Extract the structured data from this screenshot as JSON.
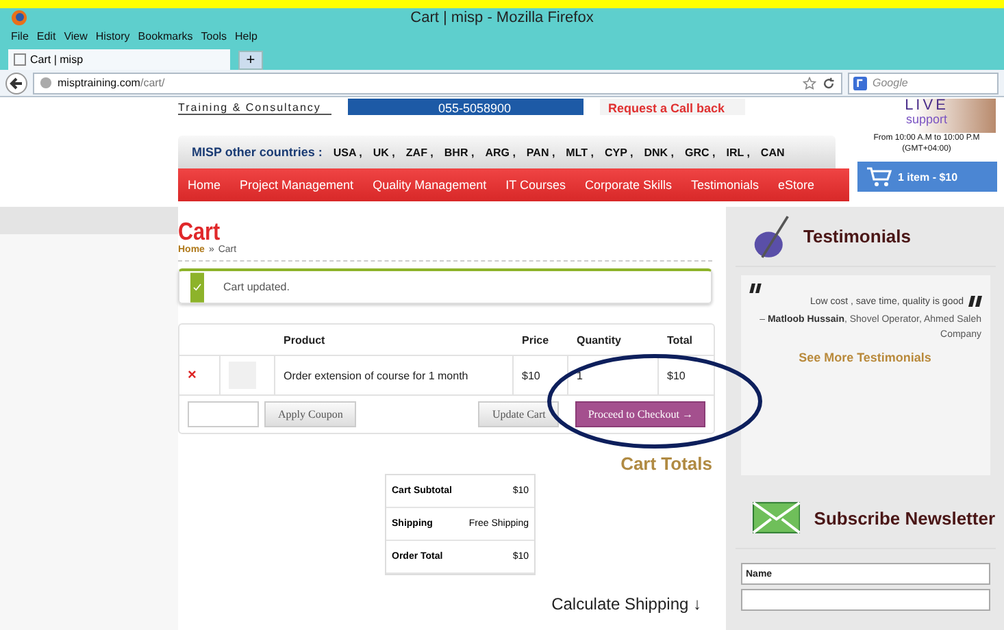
{
  "browser": {
    "title": "Cart | misp - Mozilla Firefox",
    "menu": [
      "File",
      "Edit",
      "View",
      "History",
      "Bookmarks",
      "Tools",
      "Help"
    ],
    "tabs": [
      {
        "label": "Cart | misp",
        "selected": true
      }
    ],
    "new_tab": "+",
    "url_host": "misptraining.com",
    "url_path": "/cart/",
    "search_placeholder": "Google"
  },
  "header": {
    "brand": "Training & Consultancy",
    "phone": "055-5058900",
    "callback": "Request a Call back",
    "live": "LIVE",
    "support": "support",
    "hours": "From 10:00 A.M to 10:00 P.M",
    "timezone": "(GMT+04:00)",
    "cart_button": "1 item - $10"
  },
  "countries": {
    "label": "MISP other countries :",
    "items": [
      "USA ,",
      "UK ,",
      "ZAF ,",
      "BHR ,",
      "ARG ,",
      "PAN ,",
      "MLT ,",
      "CYP ,",
      "DNK ,",
      "GRC ,",
      "IRL ,",
      "CAN"
    ]
  },
  "nav": [
    "Home",
    "Project Management",
    "Quality Management",
    "IT Courses",
    "Corporate Skills",
    "Testimonials",
    "eStore"
  ],
  "cart": {
    "title": "Cart",
    "breadcrumb_home": "Home",
    "breadcrumb_sep": "»",
    "breadcrumb_current": "Cart",
    "message": "Cart updated.",
    "columns": [
      "Product",
      "Price",
      "Quantity",
      "Total"
    ],
    "rows": [
      {
        "remove": "×",
        "product": "Order extension of course for 1 month",
        "price": "$10",
        "quantity": "1",
        "total": "$10"
      }
    ],
    "coupon_button": "Apply Coupon",
    "update_button": "Update Cart",
    "checkout_button": "Proceed to Checkout →"
  },
  "totals": {
    "title": "Cart Totals",
    "rows": [
      {
        "label": "Cart Subtotal",
        "value": "$10"
      },
      {
        "label": "Shipping",
        "value": "Free Shipping"
      },
      {
        "label": "Order Total",
        "value": "$10"
      }
    ]
  },
  "calculate_shipping": "Calculate Shipping ↓",
  "sidebar": {
    "testimonials_title": "Testimonials",
    "quote": "Low cost , save time, quality is good",
    "author": "– **Matloob Hussain**, Shovel Operator, Ahmed Saleh Company",
    "more_link": "See More Testimonials",
    "newsletter_title": "Subscribe Newsletter",
    "name_placeholder": "Name"
  },
  "annotation": {
    "kind": "ellipse"
  }
}
